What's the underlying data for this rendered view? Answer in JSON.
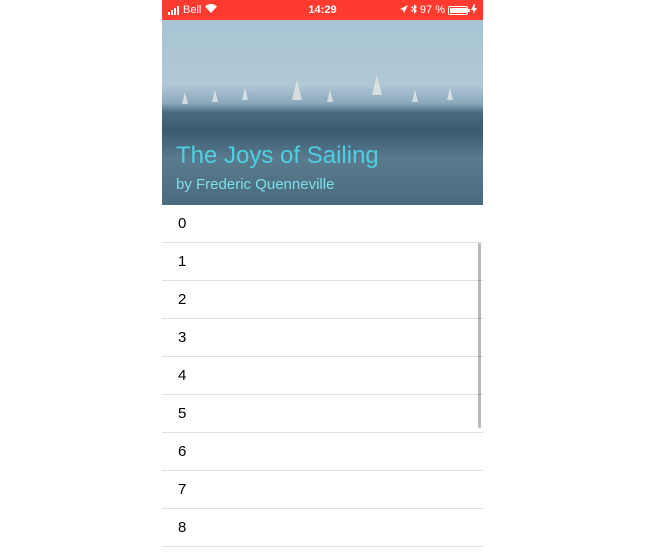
{
  "status_bar": {
    "carrier": "Bell",
    "time": "14:29",
    "battery_percent": "97 %"
  },
  "header": {
    "title": "The Joys of Sailing",
    "author": "by Frederic Quenneville"
  },
  "list": {
    "items": [
      "0",
      "1",
      "2",
      "3",
      "4",
      "5",
      "6",
      "7",
      "8"
    ]
  }
}
